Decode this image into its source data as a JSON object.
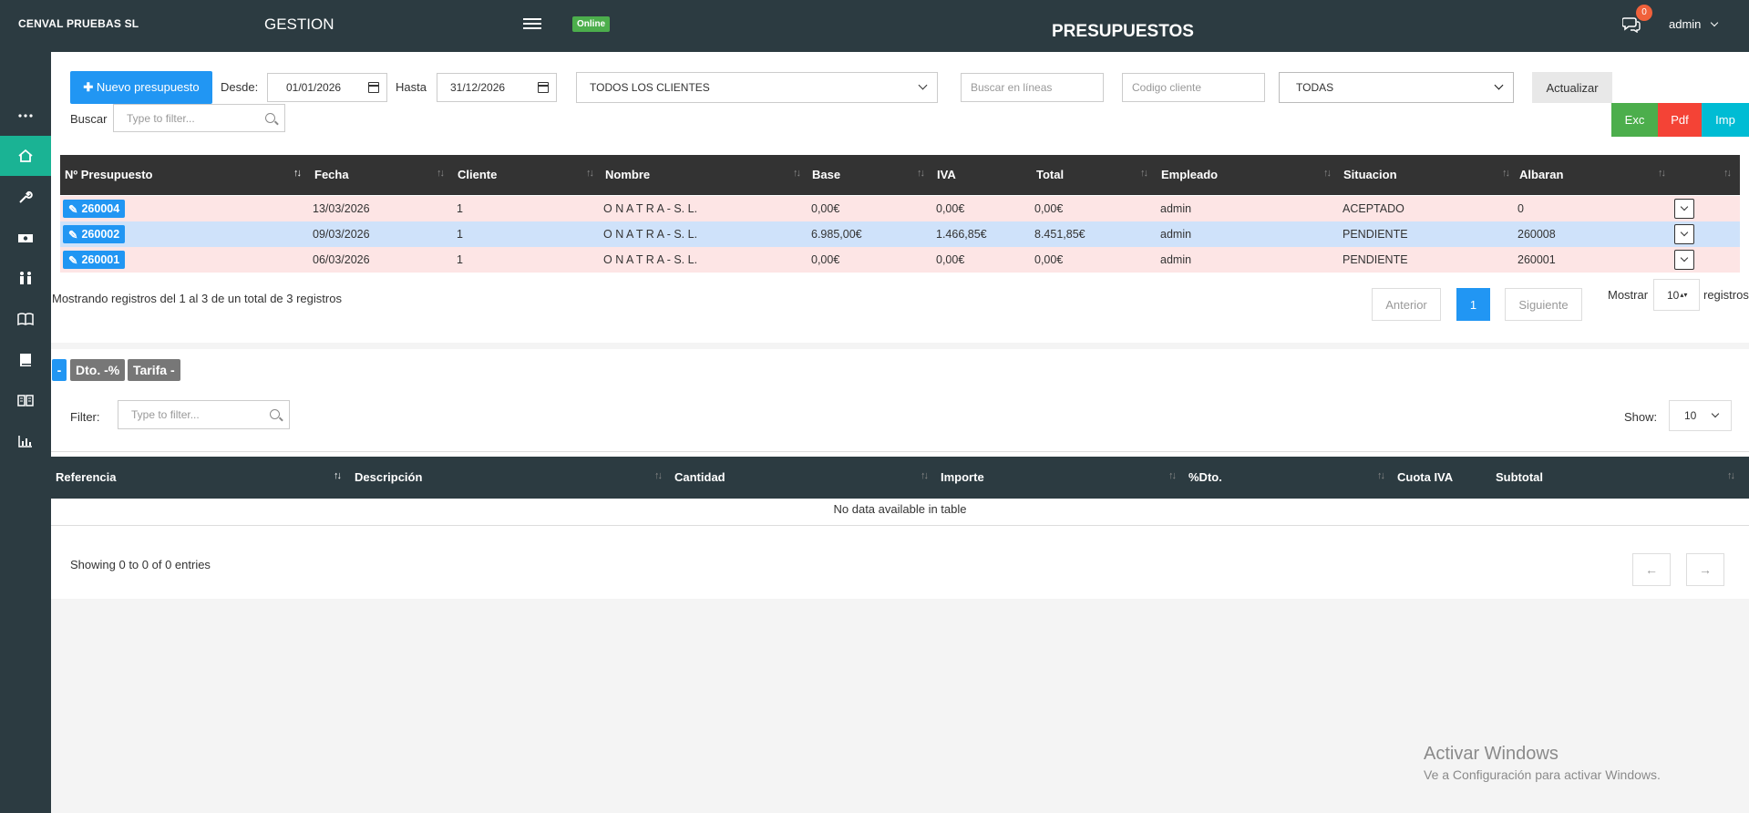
{
  "header": {
    "company": "CENVAL PRUEBAS SL",
    "app": "GESTION",
    "status": "Online",
    "title": "PRESUPUESTOS",
    "notifications": "0",
    "user": "admin"
  },
  "sidebar": {
    "items": [
      "more-icon",
      "home-icon",
      "wrench-icon",
      "money-icon",
      "users-icon",
      "book-open-icon",
      "book-icon",
      "reader-icon",
      "bar-chart-icon"
    ],
    "active": "home-icon",
    "accent": "#1ab394"
  },
  "toolbar": {
    "new_label": "Nuevo presupuesto",
    "from_label": "Desde:",
    "from_value": "01/01/2026",
    "to_label": "Hasta",
    "to_value": "31/12/2026",
    "client_select": "TODOS LOS CLIENTES",
    "search_lines_placeholder": "Buscar en líneas",
    "client_code_placeholder": "Codigo cliente",
    "state_select": "TODAS",
    "update_label": "Actualizar",
    "search_label": "Buscar",
    "filter_placeholder": "Type to filter...",
    "export": {
      "exc": "Exc",
      "pdf": "Pdf",
      "imp": "Imp"
    }
  },
  "table": {
    "headers": [
      "Nº Presupuesto",
      "Fecha",
      "Cliente",
      "Nombre",
      "Base",
      "IVA",
      "Total",
      "Empleado",
      "Situacion",
      "Albaran"
    ],
    "rows": [
      {
        "id": "260004",
        "fecha": "13/03/2026",
        "cliente": "1",
        "nombre": "O N A T R A - S. L.",
        "base": "0,00€",
        "iva": "0,00€",
        "total": "0,00€",
        "empleado": "admin",
        "situacion": "ACEPTADO",
        "albaran": "0",
        "color": "#fde5e5"
      },
      {
        "id": "260002",
        "fecha": "09/03/2026",
        "cliente": "1",
        "nombre": "O N A T R A - S. L.",
        "base": "6.985,00€",
        "iva": "1.466,85€",
        "total": "8.451,85€",
        "empleado": "admin",
        "situacion": "PENDIENTE",
        "albaran": "260008",
        "color": "#cfe2fa"
      },
      {
        "id": "260001",
        "fecha": "06/03/2026",
        "cliente": "1",
        "nombre": "O N A T R A - S. L.",
        "base": "0,00€",
        "iva": "0,00€",
        "total": "0,00€",
        "empleado": "admin",
        "situacion": "PENDIENTE",
        "albaran": "260001",
        "color": "#fde5e5"
      }
    ],
    "info": "Mostrando registros del 1 al 3 de un total de 3 registros",
    "prev": "Anterior",
    "page": "1",
    "next": "Siguiente",
    "show_label": "Mostrar",
    "show_value": "10",
    "show_suffix": "registros"
  },
  "lines": {
    "tags": [
      "-",
      "Dto. -%",
      "Tarifa -"
    ],
    "filter_label": "Filter:",
    "filter_placeholder": "Type to filter...",
    "show_label": "Show:",
    "show_value": "10",
    "headers": [
      "Referencia",
      "Descripción",
      "Cantidad",
      "Importe",
      "%Dto.",
      "Cuota IVA",
      "Subtotal"
    ],
    "empty": "No data available in table",
    "info": "Showing 0 to 0 of 0 entries",
    "prev": "←",
    "next": "→"
  },
  "watermark": {
    "line1": "Activar Windows",
    "line2": "Ve a Configuración para activar Windows."
  }
}
